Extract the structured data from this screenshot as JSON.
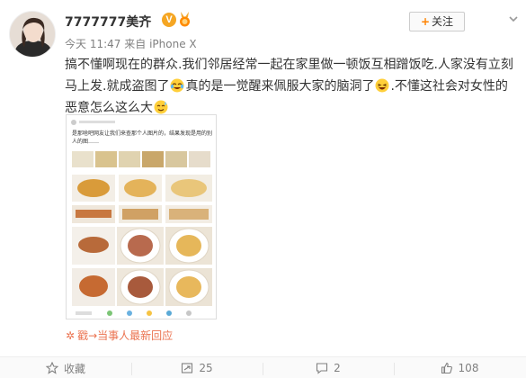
{
  "post": {
    "username": "7777777美齐",
    "timestamp": "今天 11:47",
    "source_prefix": "来自",
    "source_device": "iPhone X",
    "follow_label": "关注",
    "text_part1": "搞不懂啊现在的群众.我们邻居经常一起在家里做一顿饭互相蹭饭吃.人家没有立刻马上发.就成盗图了",
    "text_part2": "真的是一觉醒来佩服大家的脑洞了",
    "text_part3": ".不懂这社会对女性的恶意怎么这么大",
    "embedded_caption": "是那啥吧网友让我们来查那个人图片的，结果发现是用的别人的图……",
    "source_link_label": "戳→当事人最新回应"
  },
  "actions": {
    "favorite_label": "收藏",
    "repost_count": "25",
    "comment_count": "2",
    "like_count": "108"
  },
  "icons": {
    "vip": "verified-v-icon",
    "medal": "medal-icon",
    "chevron": "chevron-down-icon",
    "emoji_cry": "crying-laughing-emoji-icon",
    "emoji_laugh": "laughing-emoji-icon",
    "emoji_sweat": "sweat-smile-emoji-icon",
    "favorite": "star-icon",
    "repost": "repost-icon",
    "comment": "comment-icon",
    "like": "thumbs-up-icon",
    "source": "spark-icon"
  },
  "colors": {
    "accent": "#ff8200",
    "link": "#eb7350",
    "text": "#333333",
    "meta": "#808080"
  }
}
